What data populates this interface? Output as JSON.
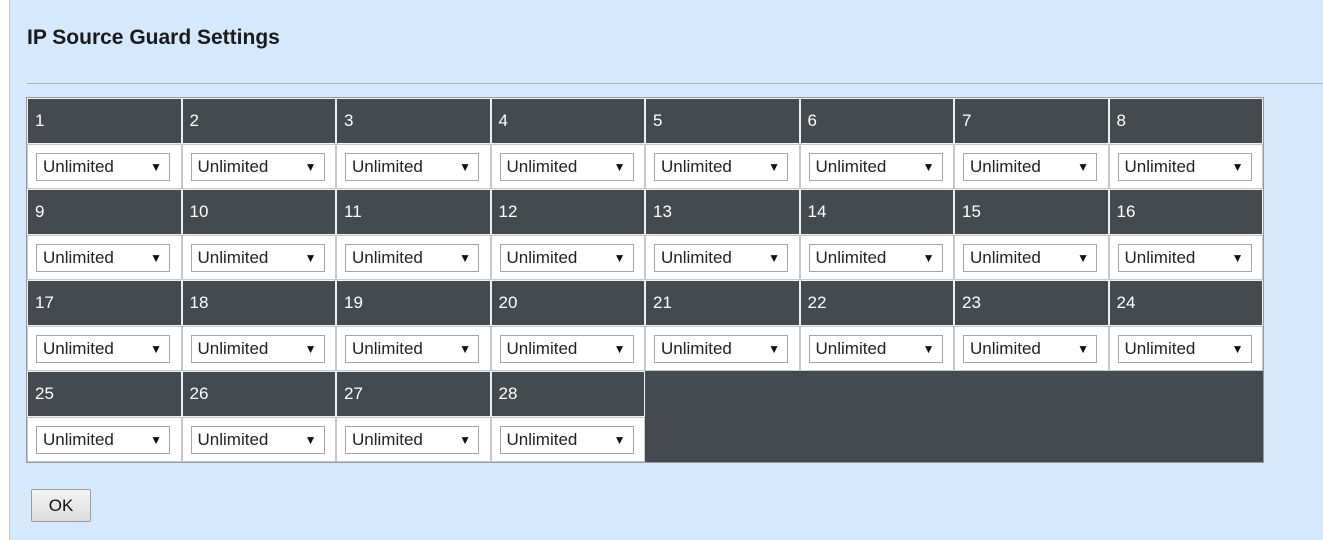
{
  "page": {
    "title": "IP Source Guard Settings"
  },
  "ports": [
    {
      "label": "1",
      "value": "Unlimited"
    },
    {
      "label": "2",
      "value": "Unlimited"
    },
    {
      "label": "3",
      "value": "Unlimited"
    },
    {
      "label": "4",
      "value": "Unlimited"
    },
    {
      "label": "5",
      "value": "Unlimited"
    },
    {
      "label": "6",
      "value": "Unlimited"
    },
    {
      "label": "7",
      "value": "Unlimited"
    },
    {
      "label": "8",
      "value": "Unlimited"
    },
    {
      "label": "9",
      "value": "Unlimited"
    },
    {
      "label": "10",
      "value": "Unlimited"
    },
    {
      "label": "11",
      "value": "Unlimited"
    },
    {
      "label": "12",
      "value": "Unlimited"
    },
    {
      "label": "13",
      "value": "Unlimited"
    },
    {
      "label": "14",
      "value": "Unlimited"
    },
    {
      "label": "15",
      "value": "Unlimited"
    },
    {
      "label": "16",
      "value": "Unlimited"
    },
    {
      "label": "17",
      "value": "Unlimited"
    },
    {
      "label": "18",
      "value": "Unlimited"
    },
    {
      "label": "19",
      "value": "Unlimited"
    },
    {
      "label": "20",
      "value": "Unlimited"
    },
    {
      "label": "21",
      "value": "Unlimited"
    },
    {
      "label": "22",
      "value": "Unlimited"
    },
    {
      "label": "23",
      "value": "Unlimited"
    },
    {
      "label": "24",
      "value": "Unlimited"
    },
    {
      "label": "25",
      "value": "Unlimited"
    },
    {
      "label": "26",
      "value": "Unlimited"
    },
    {
      "label": "27",
      "value": "Unlimited"
    },
    {
      "label": "28",
      "value": "Unlimited"
    }
  ],
  "ok_button": {
    "label": "OK"
  },
  "icons": {
    "dropdown": "dropdown-arrow-icon"
  },
  "colors": {
    "panel_bg": "#d6e8fc",
    "header_bg": "#444a4e",
    "header_text": "#ffffff"
  }
}
